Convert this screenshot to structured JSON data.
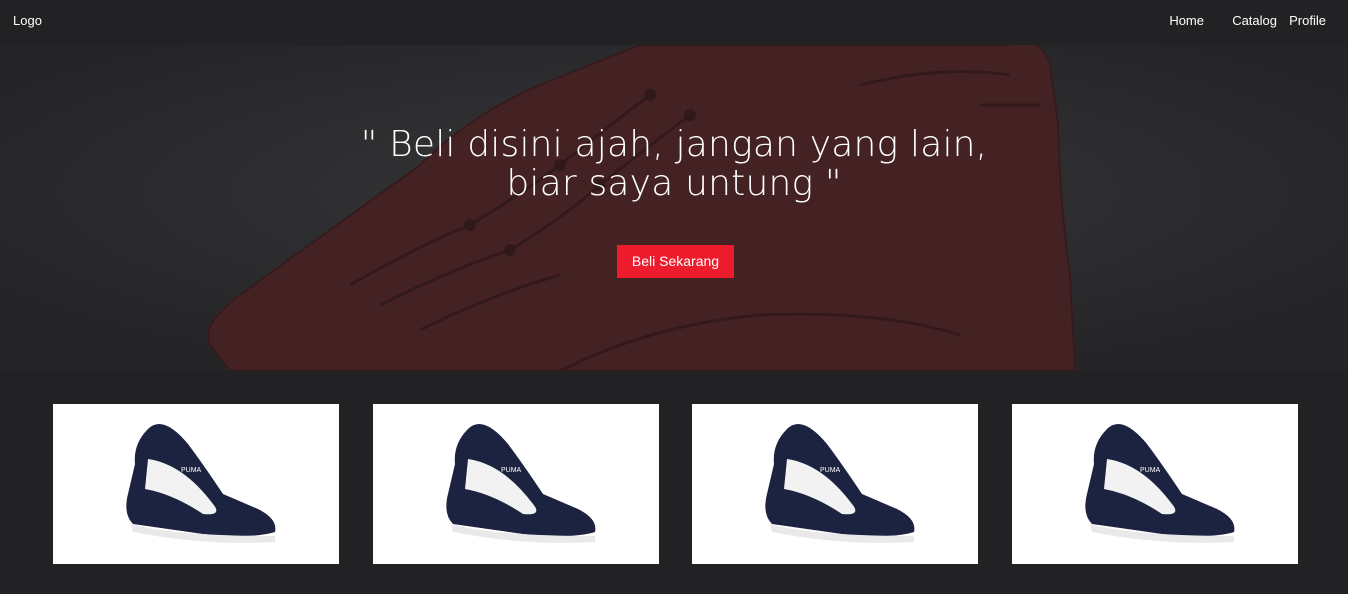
{
  "navbar": {
    "logo": "Logo",
    "links": [
      {
        "label": "Home"
      },
      {
        "label": "Catalog"
      },
      {
        "label": "Profile"
      }
    ]
  },
  "hero": {
    "quote": "\" Beli disini ajah, jangan yang lain, biar saya untung \"",
    "cta_label": "Beli Sekarang",
    "background_image": "red-sneaker-photo"
  },
  "products": [
    {
      "image": "navy-puma-sneaker-photo",
      "brand_mark": "PUMA"
    },
    {
      "image": "navy-puma-sneaker-photo",
      "brand_mark": "PUMA"
    },
    {
      "image": "navy-puma-sneaker-photo",
      "brand_mark": "PUMA"
    },
    {
      "image": "navy-puma-sneaker-photo",
      "brand_mark": "PUMA"
    }
  ],
  "colors": {
    "page_background": "#222124",
    "accent": "#ec1c2d",
    "text": "#ffffff",
    "hero_shoe": "#5e2a2a",
    "product_shoe": "#1c2340"
  }
}
